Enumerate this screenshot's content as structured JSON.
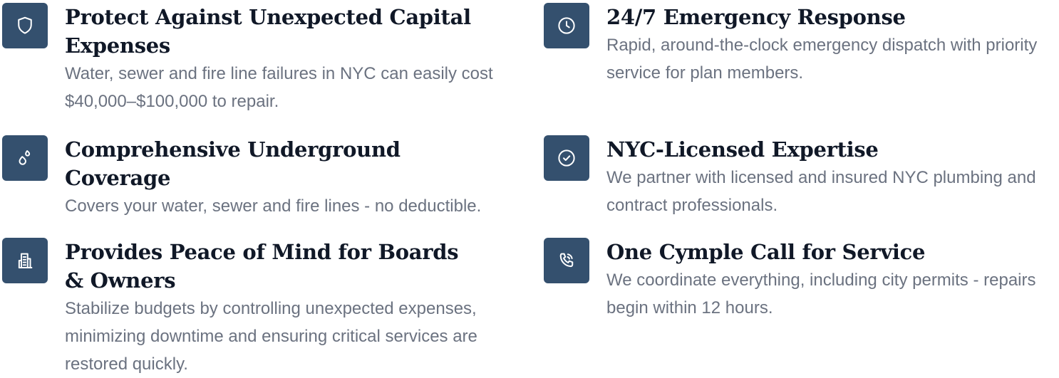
{
  "features": [
    {
      "icon": "shield-icon",
      "title": "Protect Against Unexpected Capital Expenses",
      "description": "Water, sewer and fire line failures in NYC can easily cost $40,000–$100,000 to repair."
    },
    {
      "icon": "clock-icon",
      "title": "24/7 Emergency Response",
      "description": "Rapid, around-the-clock emergency dispatch with priority service for plan members."
    },
    {
      "icon": "droplets-icon",
      "title": "Comprehensive Underground Coverage",
      "description": "Covers your water, sewer and fire lines - no deductible."
    },
    {
      "icon": "check-circle-icon",
      "title": "NYC-Licensed Expertise",
      "description": "We partner with licensed and insured NYC plumbing and contract professionals."
    },
    {
      "icon": "building-icon",
      "title": "Provides Peace of Mind for Boards & Owners",
      "description": "Stabilize budgets by controlling unexpected expenses, minimizing downtime and ensuring critical services are restored quickly."
    },
    {
      "icon": "phone-call-icon",
      "title": "One Cymple Call for Service",
      "description": "We coordinate everything, including city permits - repairs begin within 12 hours."
    }
  ],
  "colors": {
    "icon_bg": "#34506e",
    "title": "#101827",
    "description": "#6b7280"
  }
}
